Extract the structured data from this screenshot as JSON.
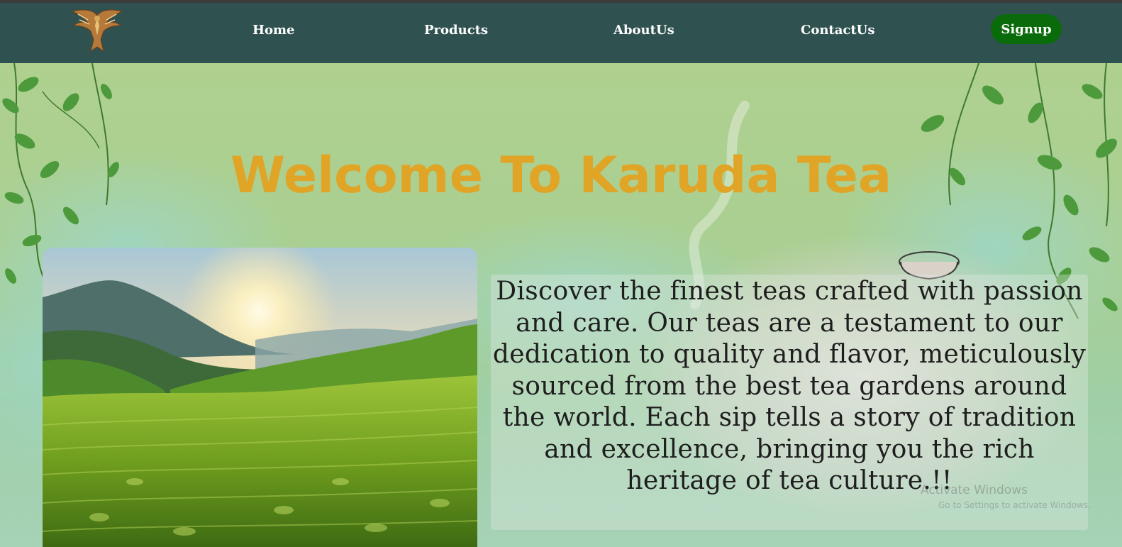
{
  "nav": {
    "logo_icon": "eagle-logo-icon",
    "items": [
      {
        "label": "Home"
      },
      {
        "label": "Products"
      },
      {
        "label": "AboutUs"
      },
      {
        "label": "ContactUs"
      }
    ],
    "signup_label": "Signup"
  },
  "hero": {
    "title": "Welcome To Karuda Tea",
    "description": "Discover the finest teas crafted with passion and care. Our teas are a testament to our dedication to quality and flavor, meticulously sourced from the best tea gardens around the world. Each sip tells a story of tradition and excellence, bringing you the rich heritage of tea culture.!!"
  },
  "watermark": {
    "line1": "Activate Windows",
    "line2": "Go to Settings to activate Windows."
  },
  "colors": {
    "navbar": "#2f5150",
    "signup": "#0a6b0a",
    "title": "#e0a526",
    "background": "#aecf8e"
  }
}
